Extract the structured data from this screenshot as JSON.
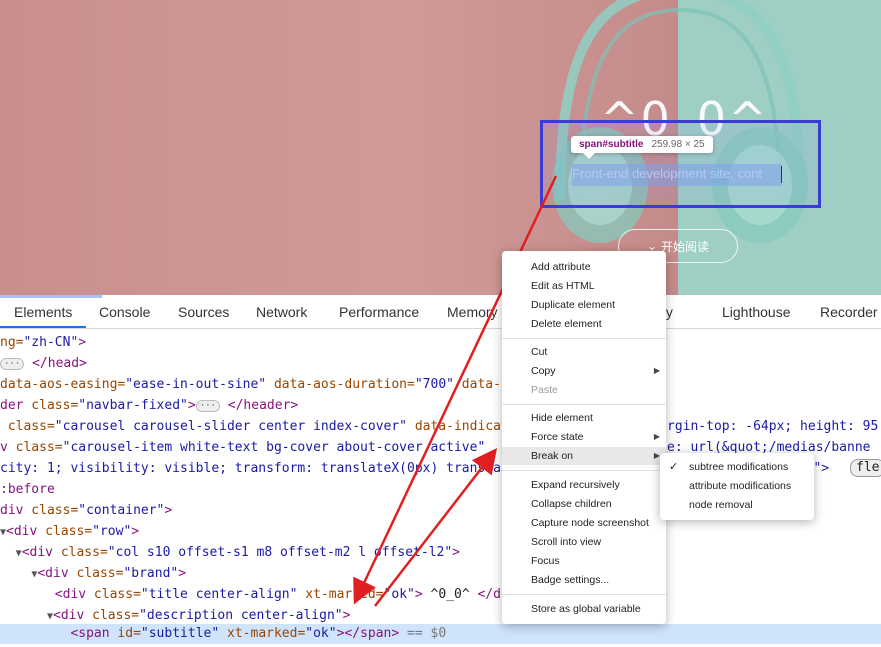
{
  "hero": {
    "title": "^0_0^",
    "subtitle_text": "Front-end development site, cont",
    "tooltip_selector": "span#subtitle",
    "tooltip_size": "259.98 × 25",
    "read_button_label": "开始阅读",
    "read_button_icon": "double-chevron-down-icon"
  },
  "devtools": {
    "tabs": [
      "Elements",
      "Console",
      "Sources",
      "Network",
      "Performance",
      "Memory",
      "ty",
      "Lighthouse",
      "Recorder"
    ],
    "active_tab": "Elements",
    "code": {
      "l1_a": "ng=",
      "l1_b": "\"zh-CN\"",
      "l1_c": ">",
      "l2_a": "</head>",
      "l3_attr1": "data-aos-easing=",
      "l3_val1": "\"ease-in-out-sine\"",
      "l3_attr2": " data-aos-duration=",
      "l3_val2": "\"700\"",
      "l3_attr3": " data-",
      "l4_a": "der",
      "l4_attr": " class=",
      "l4_val": "\"navbar-fixed\"",
      "l4_b": ">",
      "l4_c": "</header>",
      "l5_attr": " class=",
      "l5_val": "\"carousel carousel-slider center index-cover\"",
      "l5_attr2": " data-indicat",
      "l5_right": "rgin-top: -64px; height: 95",
      "l6_a": "v",
      "l6_attr": " class=",
      "l6_val": "\"carousel-item white-text bg-cover about-cover active\"",
      "l6_right": "e: url(&quot;/medias/banne",
      "l7_a": "city: 1; visibility: visible; transform: translateX(0px) transla",
      "l7_right": "x);\">",
      "l7_pill": "fle",
      "l8_a": ":before",
      "l9_a": "div",
      "l9_attr": " class=",
      "l9_val": "\"container\"",
      "l9_b": ">",
      "l10_a": "<div",
      "l10_attr": " class=",
      "l10_val": "\"row\"",
      "l10_b": ">",
      "l11_a": "<div",
      "l11_attr": " class=",
      "l11_val": "\"col s10 offset-s1 m8 offset-m2 l",
      "l11_attr2": " offset-l2\"",
      "l11_b": ">",
      "l12_a": "<div",
      "l12_attr": " class=",
      "l12_val": "\"brand\"",
      "l12_b": ">",
      "l13_a": "<div",
      "l13_attr": " class=",
      "l13_val": "\"title center-align\"",
      "l13_attr2": " xt-marked=",
      "l13_val2": "\"ok\"",
      "l13_b": ">",
      "l13_text": " ^0_0^ ",
      "l13_c": "</d",
      "l14_a": "<div",
      "l14_attr": " class=",
      "l14_val": "\"description center-align\"",
      "l14_b": ">",
      "l15_a": "<span",
      "l15_attr": " id=",
      "l15_val": "\"subtitle\"",
      "l15_attr2": " xt-marked=",
      "l15_val2": "\"ok\"",
      "l15_b": "></span>",
      "l15_c": " == $0"
    }
  },
  "context_menu": {
    "items": [
      "Add attribute",
      "Edit as HTML",
      "Duplicate element",
      "Delete element",
      "Cut",
      "Copy",
      "Paste",
      "Hide element",
      "Force state",
      "Break on",
      "Expand recursively",
      "Collapse children",
      "Capture node screenshot",
      "Scroll into view",
      "Focus",
      "Badge settings...",
      "Store as global variable"
    ],
    "highlighted": "Break on",
    "submenu": [
      "subtree modifications",
      "attribute modifications",
      "node removal"
    ],
    "submenu_checked": "subtree modifications"
  },
  "colors": {
    "highlight_border": "#3b3bd6",
    "arrow": "#e02020",
    "active_tab": "#1a73e8",
    "tag": "#881280",
    "attr": "#994500",
    "value": "#1a1aa6"
  }
}
